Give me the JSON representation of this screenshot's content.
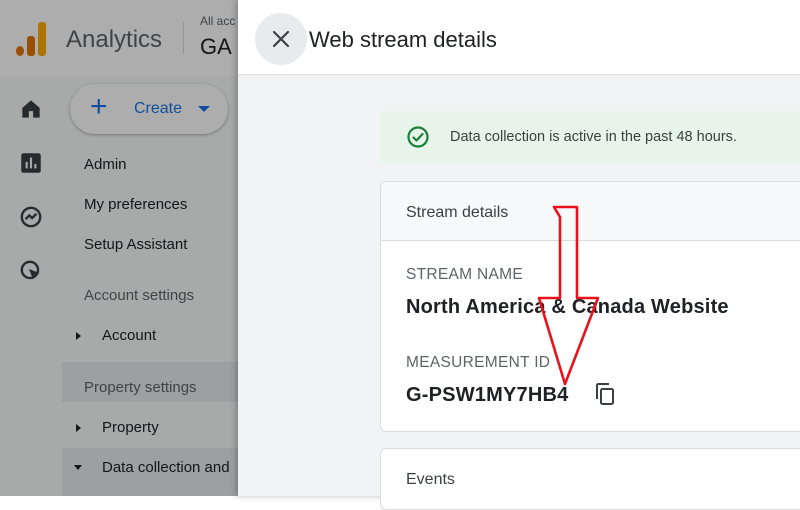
{
  "app": {
    "name": "Analytics",
    "account_crumb": "All acc",
    "account_name": "GA"
  },
  "rail": {
    "icons": [
      "home-icon",
      "reports-icon",
      "explore-icon",
      "advertising-icon"
    ]
  },
  "sidenav": {
    "create_label": "Create",
    "items": {
      "admin": "Admin",
      "my_preferences": "My preferences",
      "setup_assistant": "Setup Assistant",
      "account_settings": "Account settings",
      "account": "Account",
      "property_settings": "Property settings",
      "property": "Property",
      "data_collection": "Data collection and"
    }
  },
  "drawer": {
    "title": "Web stream details",
    "status": {
      "text": "Data collection is active in the past 48 hours.",
      "color": "#188038"
    },
    "stream_details": {
      "header": "Stream details",
      "stream_name_label": "STREAM NAME",
      "stream_name": "North America & Canada Website",
      "measurement_id_label": "MEASUREMENT ID",
      "measurement_id": "G-PSW1MY7HB4"
    },
    "events": {
      "header": "Events"
    }
  },
  "annotation": {
    "arrow_color": "#e8121c"
  }
}
